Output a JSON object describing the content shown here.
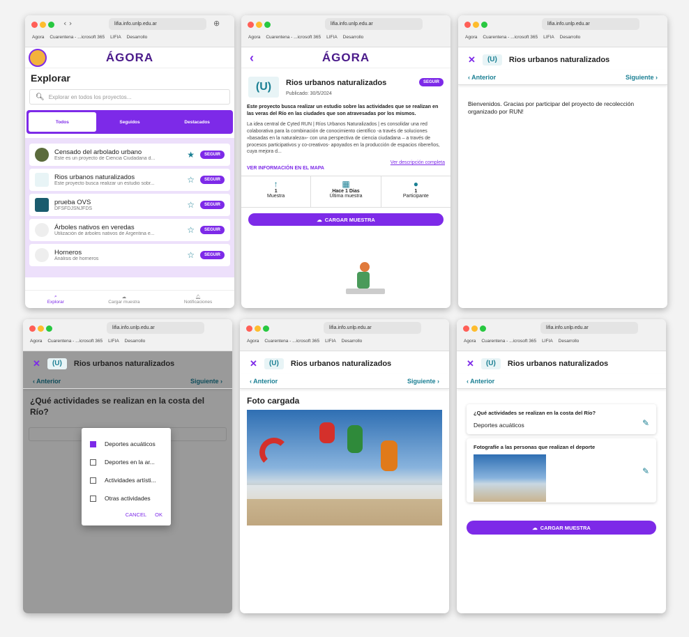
{
  "browser": {
    "url": "lifia.info.unlp.edu.ar",
    "bookmarks": [
      "Agora",
      "Cuarentena - ...icrosoft 365",
      "LIFIA",
      "Desarrollo"
    ]
  },
  "colors": {
    "accent": "#7d2ae8",
    "teal": "#1a7f93"
  },
  "app": {
    "logo": "ÁGORA"
  },
  "explore": {
    "title": "Explorar",
    "search_placeholder": "Explorar en todos los proyectos...",
    "tabs": [
      "Todos",
      "Seguidos",
      "Destacados"
    ],
    "items": [
      {
        "title": "Censado del arbolado urbano",
        "subtitle": "Este es un proyecto de Ciencia Ciudadana d...",
        "star": "★",
        "button": "SEGUIR"
      },
      {
        "title": "Rios urbanos naturalizados",
        "subtitle": "Este proyecto busca realizar un estudio sobr...",
        "star": "☆",
        "button": "SEGUIR"
      },
      {
        "title": "prueba OVS",
        "subtitle": "DFSFDJSÑJFDS",
        "star": "☆",
        "button": "SEGUIR"
      },
      {
        "title": "Árboles nativos en veredas",
        "subtitle": "Utilización de árboles nativos de Argentina e...",
        "star": "☆",
        "button": "SEGUIR"
      },
      {
        "title": "Horneros",
        "subtitle": "Análisis de horneros",
        "star": "☆",
        "button": "SEGUIR"
      }
    ],
    "bottom_nav": [
      "Explorar",
      "Cargar muestra",
      "Notificaciones"
    ]
  },
  "project": {
    "title": "Rios urbanos naturalizados",
    "follow": "SEGUIR",
    "published": "Publicado: 30/5/2024",
    "lead": "Este proyecto busca realizar un estudio sobre las actividades que se realizan en las veras del Río en las ciudades que son atravesadas por los mismos.",
    "body": "La idea central de Cyted RUN | Ríos Urbanos Naturalizados | es consolidar una red colaborativa para la combinación de conocimiento científico -a través de soluciones «basadas en la naturaleza»- con una perspectiva de ciencia ciudadana – a través de procesos participativos y co-creativos- apoyados en la producción de espacios ribereños, cuya mejora d...",
    "more_link": "Ver descripción completa",
    "map_link": "VER INFORMACIÓN EN EL MAPA",
    "stats": [
      {
        "value": "1",
        "label": "Muestra"
      },
      {
        "value": "Hace 1 Dias",
        "label": "Última muestra"
      },
      {
        "value": "1",
        "label": "Participante"
      }
    ],
    "upload": "CARGAR MUESTRA"
  },
  "form": {
    "title": "Rios urbanos naturalizados",
    "prev": "Anterior",
    "next": "Siguiente",
    "welcome": "Bienvenidos. Gracias por participar del proyecto de recolección organizado por RUN!",
    "question": "¿Qué actividades se realizan en la costa del Río?",
    "options": [
      "Deportes acuáticos",
      "Deportes en la ar...",
      "Actividades artísti...",
      "Otras actividades"
    ],
    "cancel": "CANCEL",
    "ok": "OK",
    "photo_title": "Foto cargada",
    "summary_q1": "¿Qué actividades se realizan en la costa del Río?",
    "summary_a1": "Deportes acuáticos",
    "summary_q2": "Fotografíe a las personas que realizan el deporte",
    "upload": "CARGAR MUESTRA"
  }
}
